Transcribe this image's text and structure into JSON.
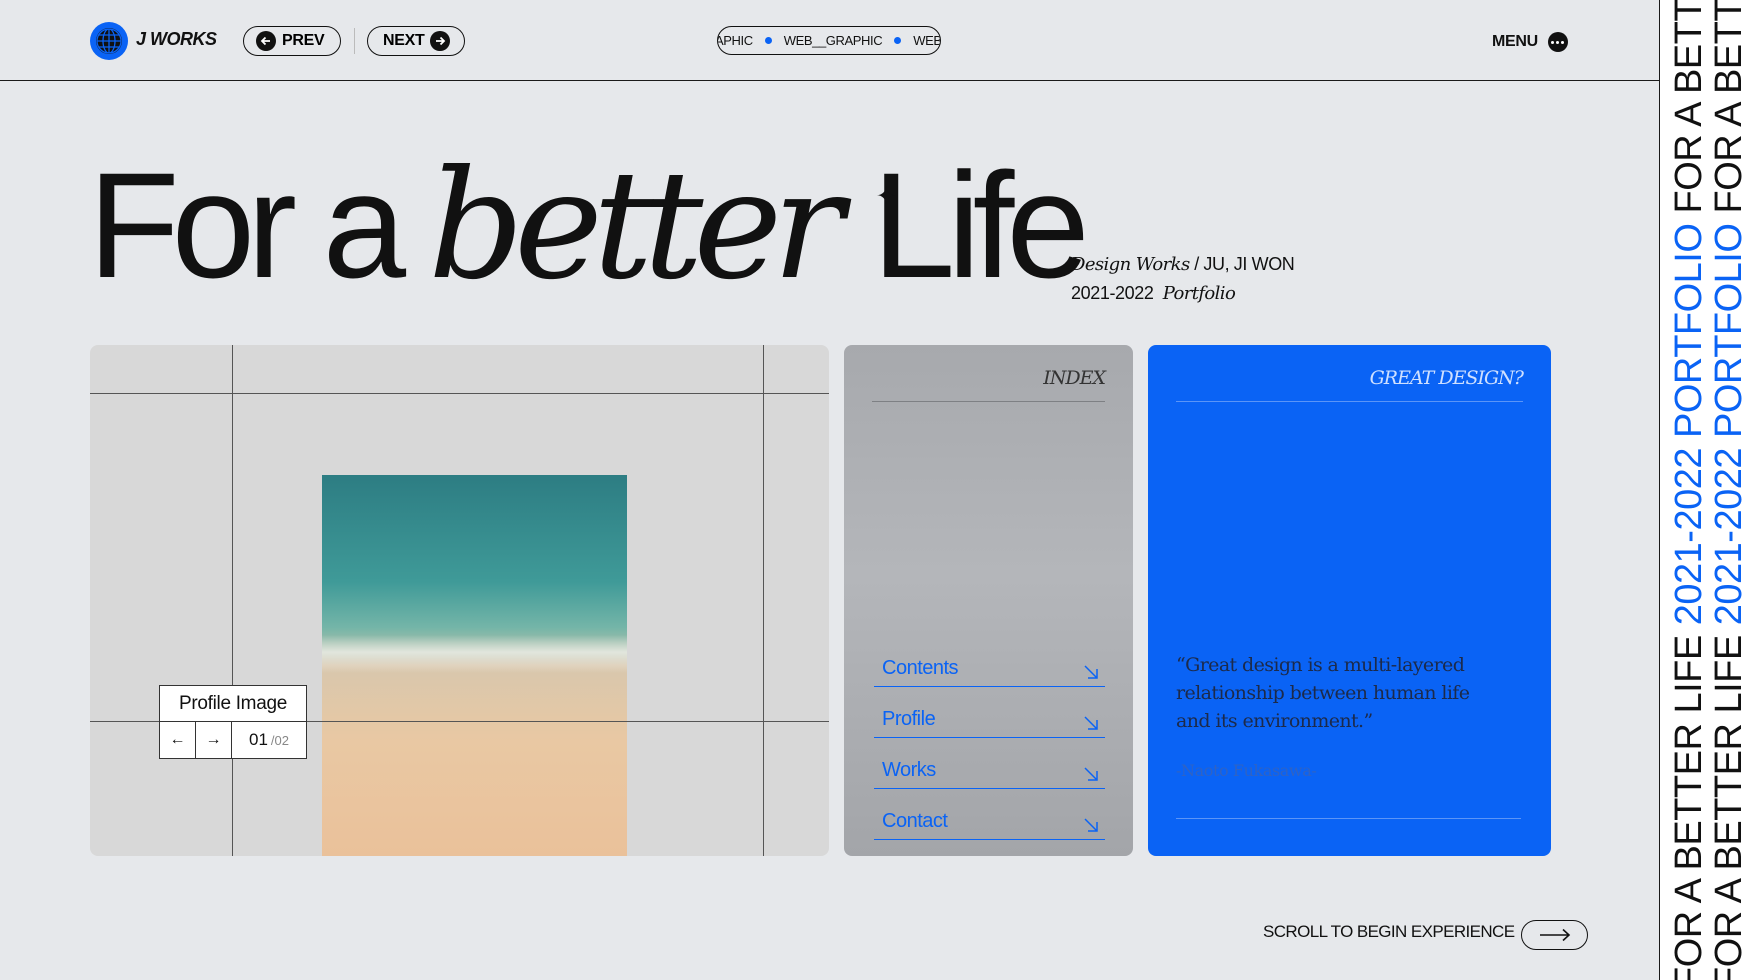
{
  "header": {
    "logo_text": "J WORKS",
    "prev_label": "PREV",
    "next_label": "NEXT",
    "ticker": [
      "APHIC",
      "WEB__GRAPHIC",
      "WEB_"
    ],
    "menu_label": "MENU"
  },
  "hero": {
    "word1": "For a",
    "word2": "better",
    "word3": "Life",
    "sub_line1_italic": "Design Works",
    "sub_line1_rest": " / JU, JI WON",
    "sub_line2_years": "2021-2022",
    "sub_line2_italic": "Portfolio"
  },
  "profile": {
    "title": "Profile Image",
    "page_current": "01",
    "page_total": "/02"
  },
  "index_panel": {
    "heading": "INDEX",
    "items": [
      {
        "label": "Contents"
      },
      {
        "label": "Profile"
      },
      {
        "label": "Works"
      },
      {
        "label": "Contact"
      }
    ]
  },
  "quote_panel": {
    "heading": "GREAT DESIGN?",
    "quote": "“Great design is a multi-layered relationship between human life and its environment.”",
    "author": "-Naoto Fukasawa-"
  },
  "scroll_cta": "SCROLL TO BEGIN EXPERIENCE",
  "strip": {
    "col1_blue_a": "2021-2022 PORTFOLIO",
    "col1_text_a": " FOR A BETTER LIFE ",
    "col1_blue_b": "2021-2022",
    "col2_blue_a": "2021-2022 PORTFOLIO",
    "col2_text_a": " FOR A BETTER LIFE ",
    "col2_blue_b": "2021-2022"
  },
  "colors": {
    "accent": "#0a63f5",
    "background": "#e6e8eb"
  }
}
